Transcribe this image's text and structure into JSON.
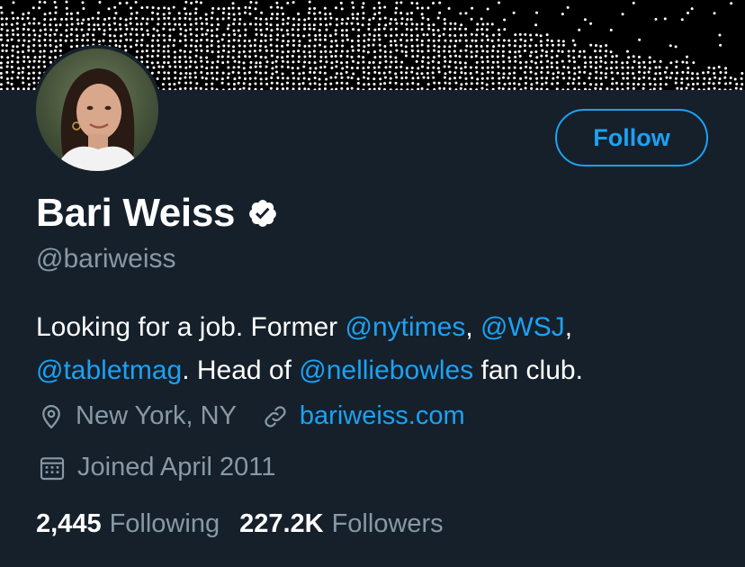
{
  "profile": {
    "name": "Bari Weiss",
    "handle": "@bariweiss",
    "follow_label": "Follow",
    "bio": {
      "t1": "Looking for a job. Former ",
      "m1": "@nytimes",
      "t2": ", ",
      "m2": "@WSJ",
      "t3": ",",
      "m3": "@tabletmag",
      "t4": ". Head of ",
      "m4": "@nelliebowles",
      "t5": " fan club."
    },
    "location": "New York, NY",
    "website": "bariweiss.com",
    "joined": "Joined April 2011",
    "following_count": "2,445",
    "following_label": "Following",
    "followers_count": "227.2K",
    "followers_label": "Followers"
  },
  "colors": {
    "background": "#15202b",
    "accent": "#1da1f2",
    "secondary_text": "#8899a6"
  },
  "icons": {
    "verified": "verified-badge-icon",
    "location": "location-pin-icon",
    "link": "link-icon",
    "calendar": "calendar-icon"
  }
}
